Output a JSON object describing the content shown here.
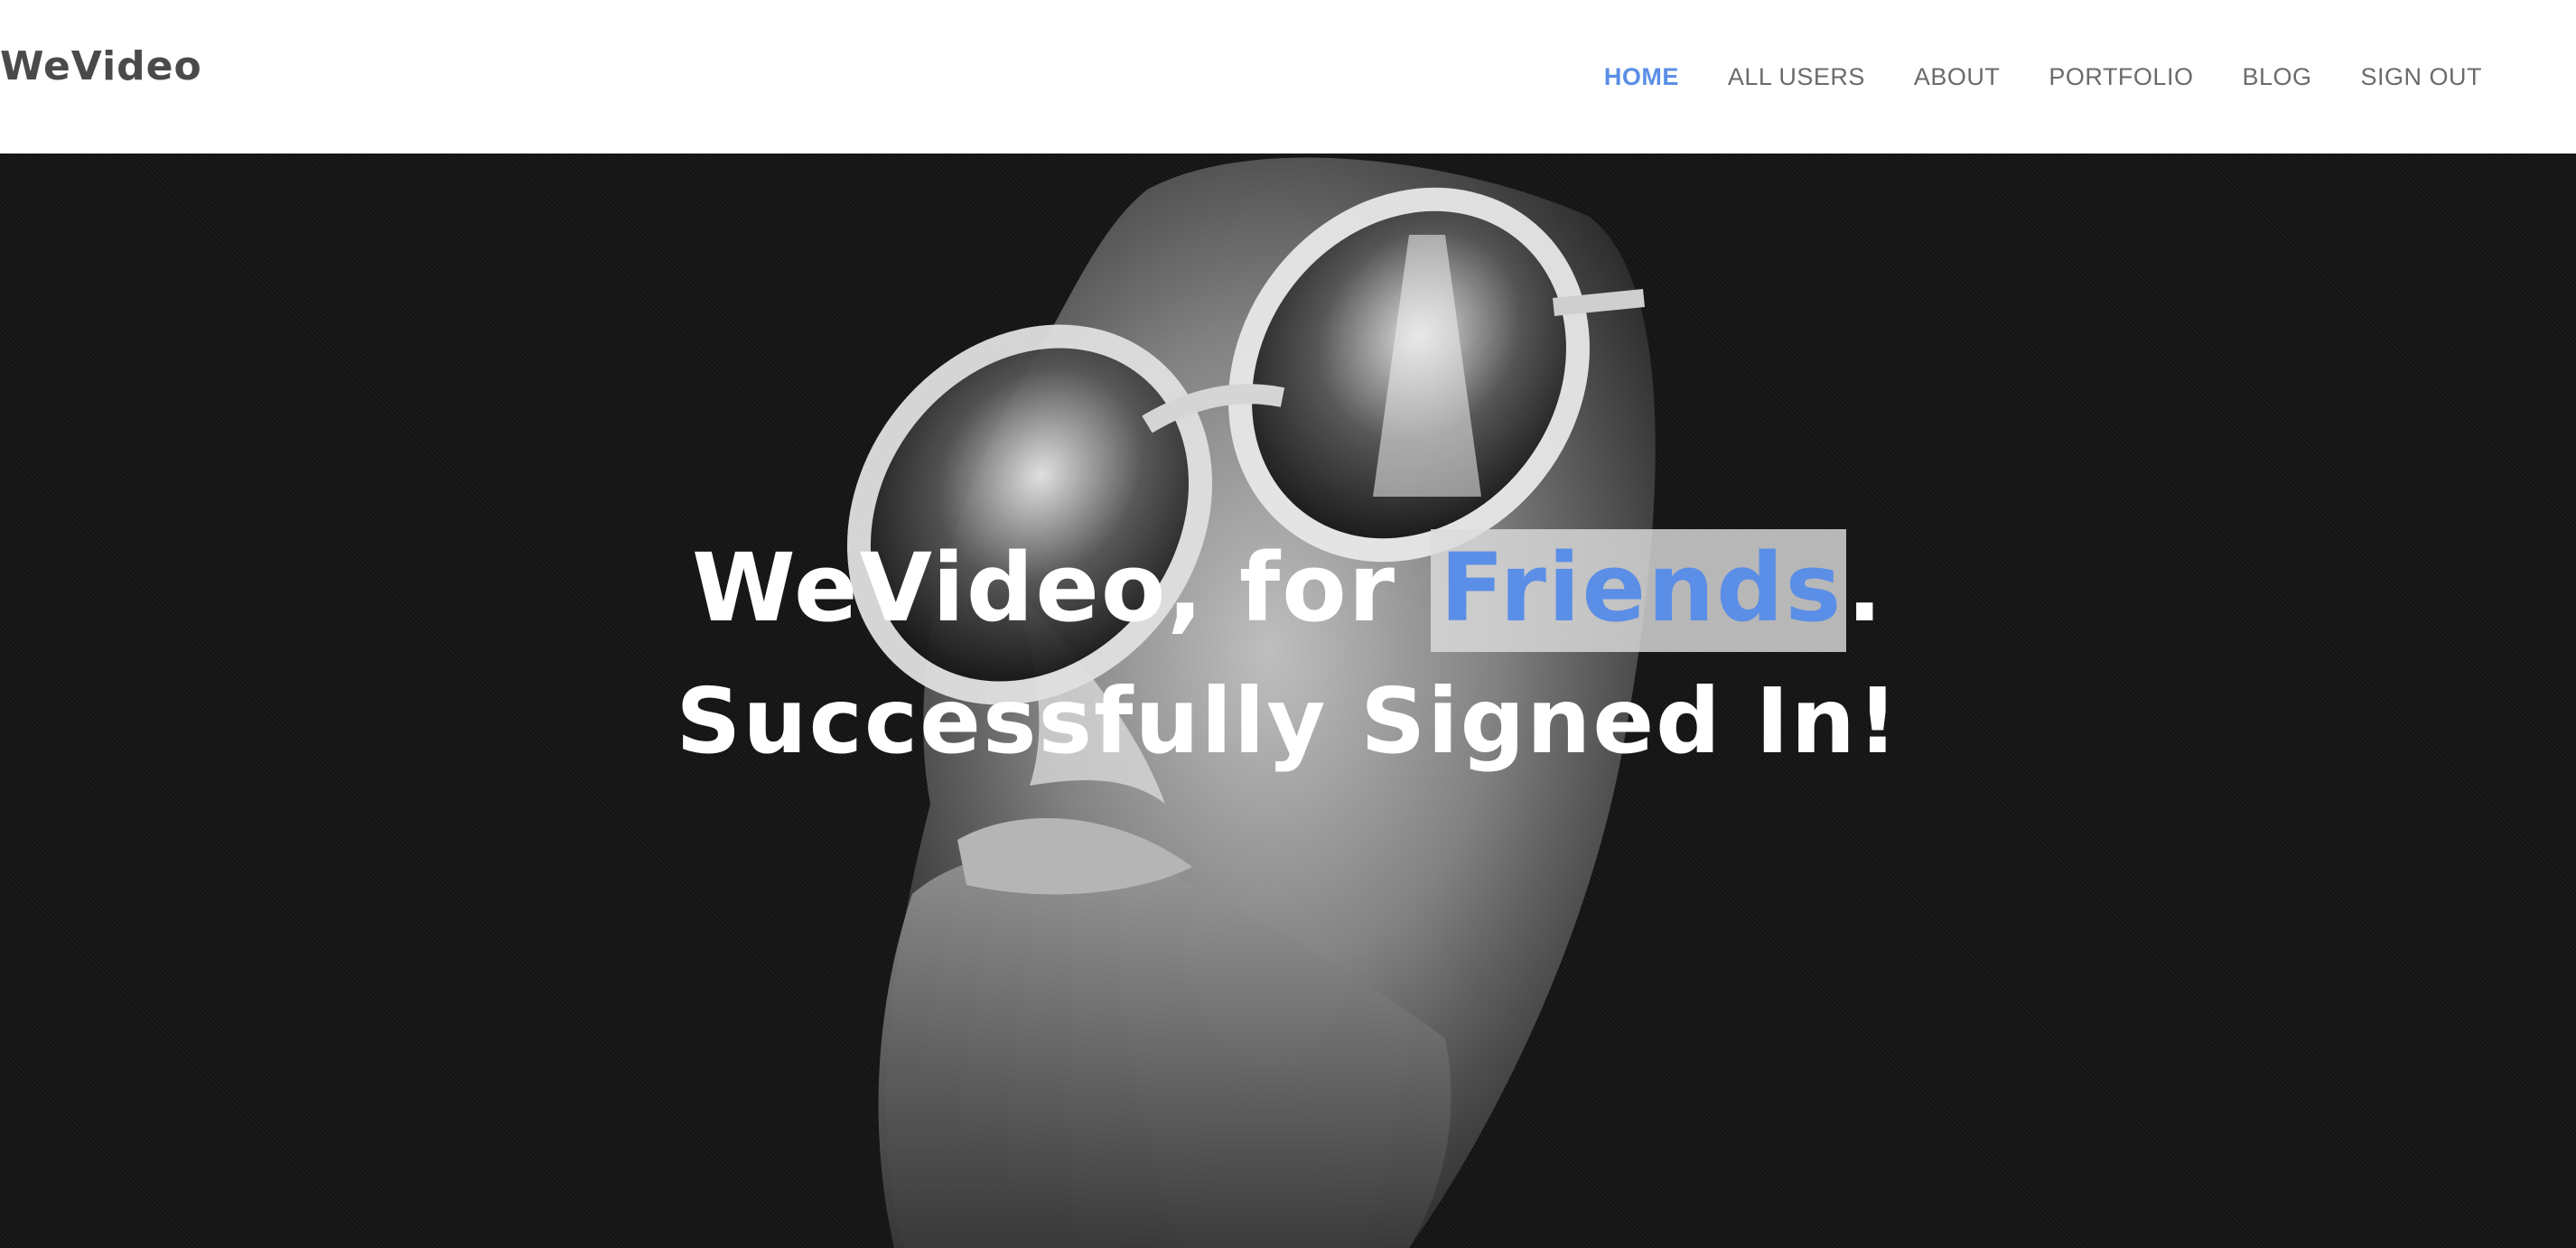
{
  "brand": {
    "name": "WeVideo"
  },
  "nav": {
    "items": [
      {
        "label": "HOME",
        "active": true
      },
      {
        "label": "ALL USERS",
        "active": false
      },
      {
        "label": "ABOUT",
        "active": false
      },
      {
        "label": "PORTFOLIO",
        "active": false
      },
      {
        "label": "BLOG",
        "active": false
      },
      {
        "label": "SIGN OUT",
        "active": false
      }
    ]
  },
  "hero": {
    "title_prefix": "WeVideo, for ",
    "title_highlight": "Friends",
    "title_suffix": ".",
    "subtitle": "Successfully Signed In!",
    "image": "grayscale-portrait-man-round-sunglasses"
  },
  "colors": {
    "accent": "#5b8ee6",
    "nav_text": "#6b6b6b",
    "brand_text": "#4a4a4a",
    "hero_bg": "#151515"
  }
}
